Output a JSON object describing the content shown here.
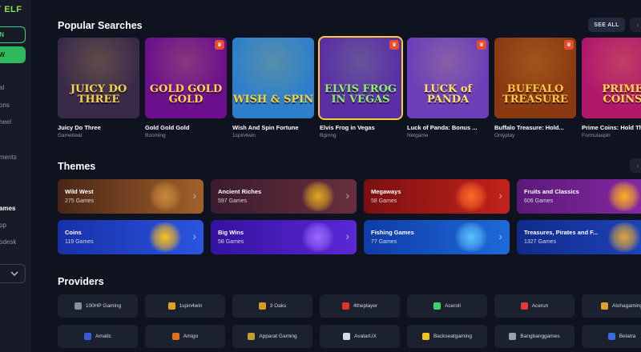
{
  "sidebar": {
    "logo": "Y ELF",
    "login_label": "N",
    "signup_label": "OW",
    "items": [
      {
        "label": "al",
        "active": false
      },
      {
        "label": "ons",
        "active": false
      },
      {
        "label": "heel",
        "active": false
      },
      {
        "label": "ments",
        "active": false
      },
      {
        "label": "ames",
        "active": true
      },
      {
        "label": "pp",
        "active": false
      },
      {
        "label": "odesk",
        "active": false
      }
    ],
    "dropdown_icon": "chevron-down-icon"
  },
  "popular": {
    "title": "Popular Searches",
    "see_all": "SEE ALL",
    "games": [
      {
        "name": "Juicy Do Three",
        "provider": "Gamebeat",
        "art": "JUICY DO THREE",
        "bg": "#3a2a4a",
        "fg": "#f7d24a",
        "badge": false
      },
      {
        "name": "Gold Gold Gold",
        "provider": "Booming",
        "art": "GOLD GOLD GOLD",
        "bg": "#6b0f8c",
        "fg": "#ffd84a",
        "badge": true
      },
      {
        "name": "Wish And Spin Fortune",
        "provider": "1spin4win",
        "art": "WISH & SPIN",
        "bg": "#2e7fc9",
        "fg": "#ffcf3a",
        "badge": false
      },
      {
        "name": "Elvis Frog in Vegas",
        "provider": "Bgmng",
        "art": "ELVIS FROG IN VEGAS",
        "bg": "#5b2ea6",
        "fg": "#8df06a",
        "badge": true
      },
      {
        "name": "Luck of Panda: Bonus ...",
        "provider": "Netgame",
        "art": "LUCK of PANDA",
        "bg": "#6a3fb8",
        "fg": "#ffe066",
        "badge": true
      },
      {
        "name": "Buffalo Treasure: Hold...",
        "provider": "Onlyplay",
        "art": "BUFFALO TREASURE",
        "bg": "#8a3a12",
        "fg": "#ffc440",
        "badge": true
      },
      {
        "name": "Prime Coins: Hold Th",
        "provider": "Formulaspin",
        "art": "PRIME COINS",
        "bg": "#b0186b",
        "fg": "#ffd84a",
        "badge": true
      }
    ]
  },
  "themes": {
    "title": "Themes",
    "items": [
      {
        "name": "Wild West",
        "count": "275 Games",
        "bg": "linear-gradient(90deg,#4a2617,#a0602a)",
        "deco": "#c9893a"
      },
      {
        "name": "Ancient Riches",
        "count": "597 Games",
        "bg": "linear-gradient(90deg,#3a1c2e,#6a2f3e)",
        "deco": "#e0a820"
      },
      {
        "name": "Megaways",
        "count": "58 Games",
        "bg": "linear-gradient(90deg,#7a1010,#c4221c)",
        "deco": "#ff6a2a"
      },
      {
        "name": "Fruits and Classics",
        "count": "606 Games",
        "bg": "linear-gradient(90deg,#5a1a78,#8c2aa8)",
        "deco": "#ffb020"
      },
      {
        "name": "Coins",
        "count": "119 Games",
        "bg": "linear-gradient(90deg,#1730a8,#2a55e0)",
        "deco": "#ffc21a"
      },
      {
        "name": "Big Wins",
        "count": "58 Games",
        "bg": "linear-gradient(90deg,#3512a0,#5a28d6)",
        "deco": "#9a6aff"
      },
      {
        "name": "Fishing Games",
        "count": "77 Games",
        "bg": "linear-gradient(90deg,#0f3ca8,#1e6ad8)",
        "deco": "#5ac0ff"
      },
      {
        "name": "Treasures, Pirates and F...",
        "count": "1327 Games",
        "bg": "linear-gradient(90deg,#0f2c8a,#2046c0)",
        "deco": "#e0a83a"
      }
    ]
  },
  "providers": {
    "title": "Providers",
    "items": [
      {
        "name": "100HP Gaming",
        "color": "#8a8fa0"
      },
      {
        "name": "1spin4win",
        "color": "#e0a020"
      },
      {
        "name": "3 Oaks",
        "color": "#d89a20"
      },
      {
        "name": "4theplayer",
        "color": "#e03030"
      },
      {
        "name": "Aceroll",
        "color": "#3ad070"
      },
      {
        "name": "Acerun",
        "color": "#e03a3a"
      },
      {
        "name": "Alohagaming",
        "color": "#e0a030"
      },
      {
        "name": "Amatic",
        "color": "#3a5ad8"
      },
      {
        "name": "Amigo",
        "color": "#e07020"
      },
      {
        "name": "Apparat Gaming",
        "color": "#c0a030"
      },
      {
        "name": "AvatarUX",
        "color": "#d8dae2"
      },
      {
        "name": "Backseatgaming",
        "color": "#f0c020"
      },
      {
        "name": "Bangbanggames",
        "color": "#9aa0b0"
      },
      {
        "name": "Belatra",
        "color": "#3a6ae0"
      }
    ]
  }
}
